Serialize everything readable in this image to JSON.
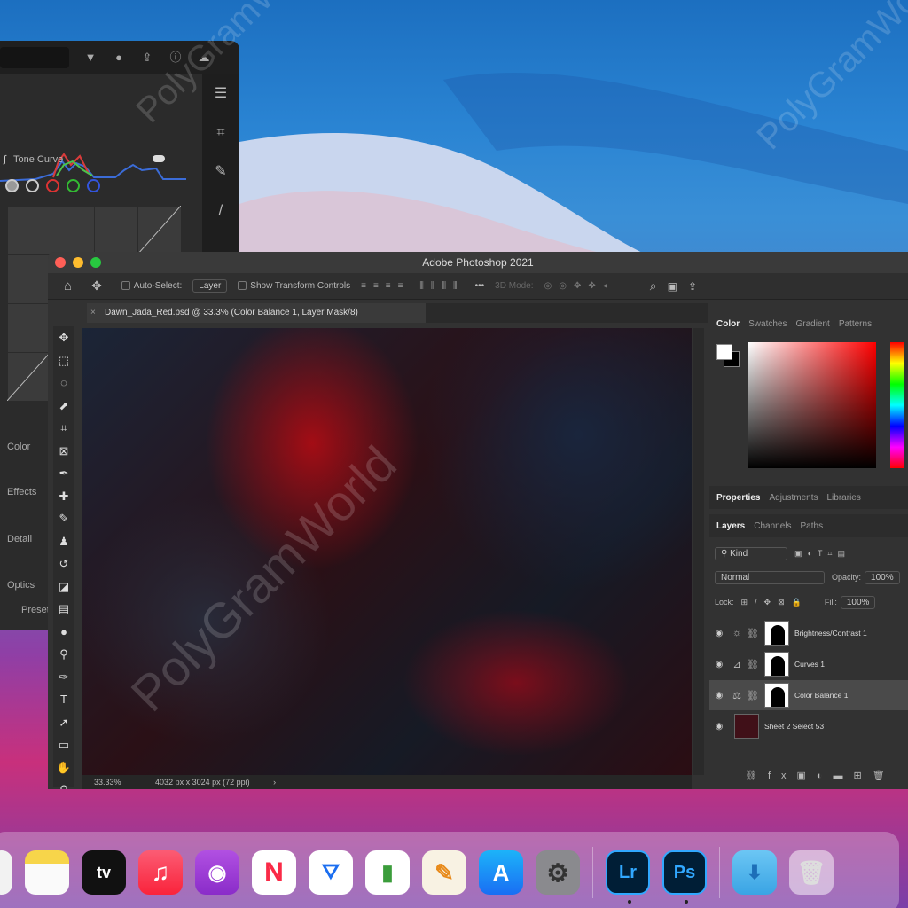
{
  "lightroom": {
    "tone_curve_label": "Tone Curve",
    "sections": [
      "Color",
      "Effects",
      "Detail",
      "Optics",
      "Presets"
    ]
  },
  "photoshop": {
    "window_title": "Adobe Photoshop 2021",
    "options": {
      "auto_select_label": "Auto-Select:",
      "layer_select_value": "Layer",
      "show_transform_label": "Show Transform Controls",
      "mode_3d_label": "3D Mode:"
    },
    "document_tab": "Dawn_Jada_Red.psd @ 33.3% (Color Balance 1, Layer Mask/8)",
    "status": {
      "zoom": "33.33%",
      "doc_info": "4032 px x 3024 px (72 ppi)"
    },
    "color_panel_tabs": [
      "Color",
      "Swatches",
      "Gradient",
      "Patterns"
    ],
    "properties_tabs": [
      "Properties",
      "Adjustments",
      "Libraries"
    ],
    "layers_tabs": [
      "Layers",
      "Channels",
      "Paths"
    ],
    "layers_panel": {
      "filter_kind": "Kind",
      "blend_mode": "Normal",
      "opacity_label": "Opacity:",
      "opacity_value": "100%",
      "lock_label": "Lock:",
      "fill_label": "Fill:",
      "fill_value": "100%",
      "layers": [
        {
          "name": "Brightness/Contrast 1",
          "icon": "sun-icon"
        },
        {
          "name": "Curves 1",
          "icon": "curves-icon"
        },
        {
          "name": "Color Balance 1",
          "icon": "balance-icon"
        },
        {
          "name": "Sheet 2 Select 53",
          "icon": "photo-icon"
        }
      ]
    }
  },
  "dock": {
    "apps": [
      "Notes",
      "Apple TV",
      "Music",
      "Podcasts",
      "News",
      "Keynote",
      "Numbers",
      "Pages",
      "App Store",
      "System Preferences",
      "Lightroom",
      "Photoshop",
      "Downloads",
      "Trash"
    ],
    "lr_label": "Lr",
    "ps_label": "Ps",
    "tv_label": "tv"
  },
  "watermark": "PolyGramWorld"
}
